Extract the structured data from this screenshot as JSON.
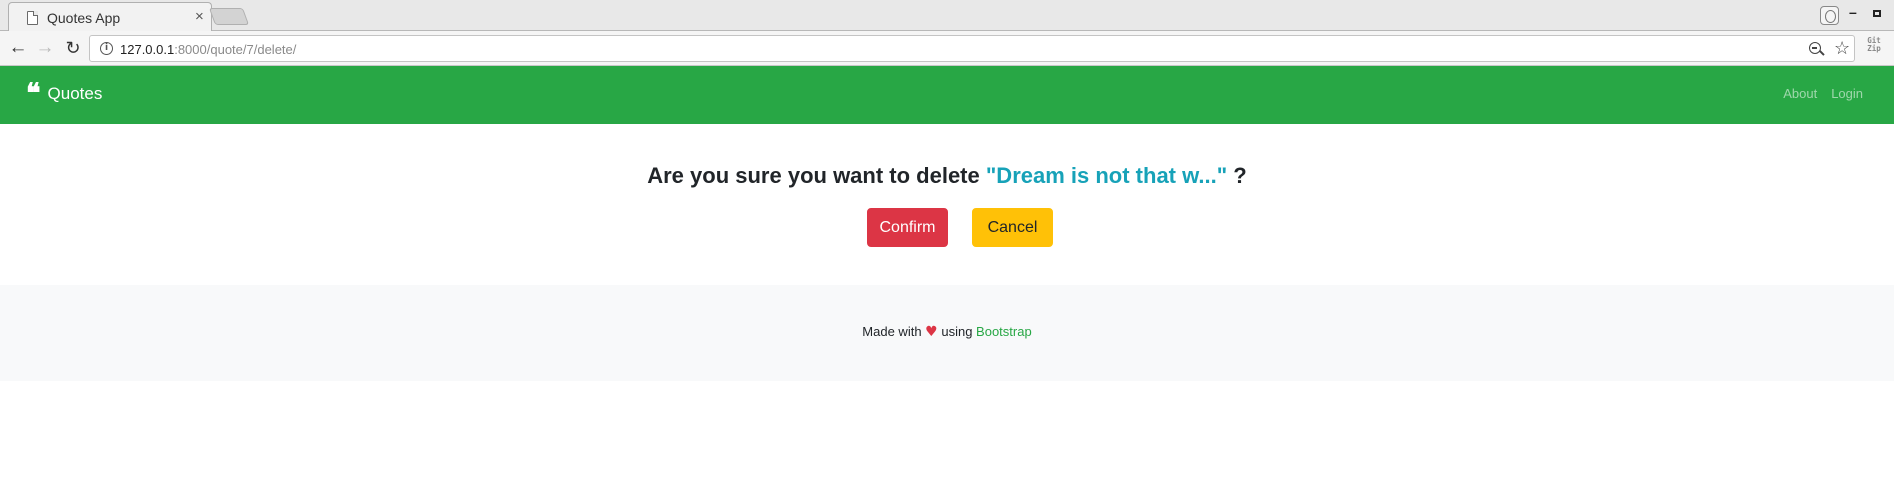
{
  "browser": {
    "tab_title": "Quotes App",
    "tab_close": "×",
    "url_host": "127.0.0.1",
    "url_path": ":8000/quote/7/delete/",
    "back_glyph": "←",
    "forward_glyph": "→",
    "reload_glyph": "↻",
    "star_glyph": "☆",
    "extension_label_top": "Git",
    "extension_label_bottom": "Zip"
  },
  "navbar": {
    "brand_icon": "quote-icon",
    "brand_glyph": "❝",
    "brand": "Quotes",
    "links": [
      "About",
      "Login"
    ],
    "background_color": "#28a745"
  },
  "main": {
    "question_prefix": "Are you sure you want to delete ",
    "quote_text": "\"Dream is not that w...\"",
    "question_suffix": " ?",
    "confirm_label": "Confirm",
    "cancel_label": "Cancel",
    "confirm_color": "#dc3545",
    "cancel_color": "#ffc107",
    "quote_color": "#17a2b8"
  },
  "footer": {
    "prefix": "Made with ",
    "heart_glyph": "♥",
    "middle": " using ",
    "link": "Bootstrap"
  }
}
